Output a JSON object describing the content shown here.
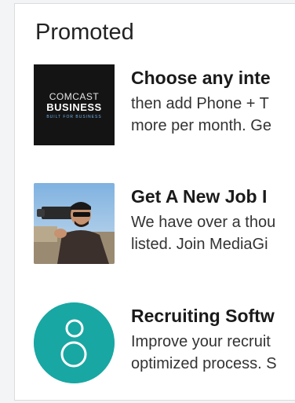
{
  "section": {
    "title": "Promoted"
  },
  "ads": [
    {
      "logo_icon": "comcast-business-logo",
      "logo_lines": [
        "COMCAST",
        "BUSINESS",
        "BUILT FOR BUSINESS"
      ],
      "title": "Choose any inte",
      "body_lines": [
        "then add Phone + T",
        "more per month. Ge"
      ]
    },
    {
      "logo_icon": "photographer-photo",
      "title": "Get A New Job I",
      "body_lines": [
        "We have over a thou",
        "listed. Join MediaGi"
      ]
    },
    {
      "logo_icon": "recruiting-software-logo",
      "title": "Recruiting Softw",
      "body_lines": [
        "Improve your recruit",
        "optimized process. S"
      ]
    }
  ],
  "colors": {
    "recruit_logo": "#19a7a3",
    "comcast_bg": "#141414"
  }
}
